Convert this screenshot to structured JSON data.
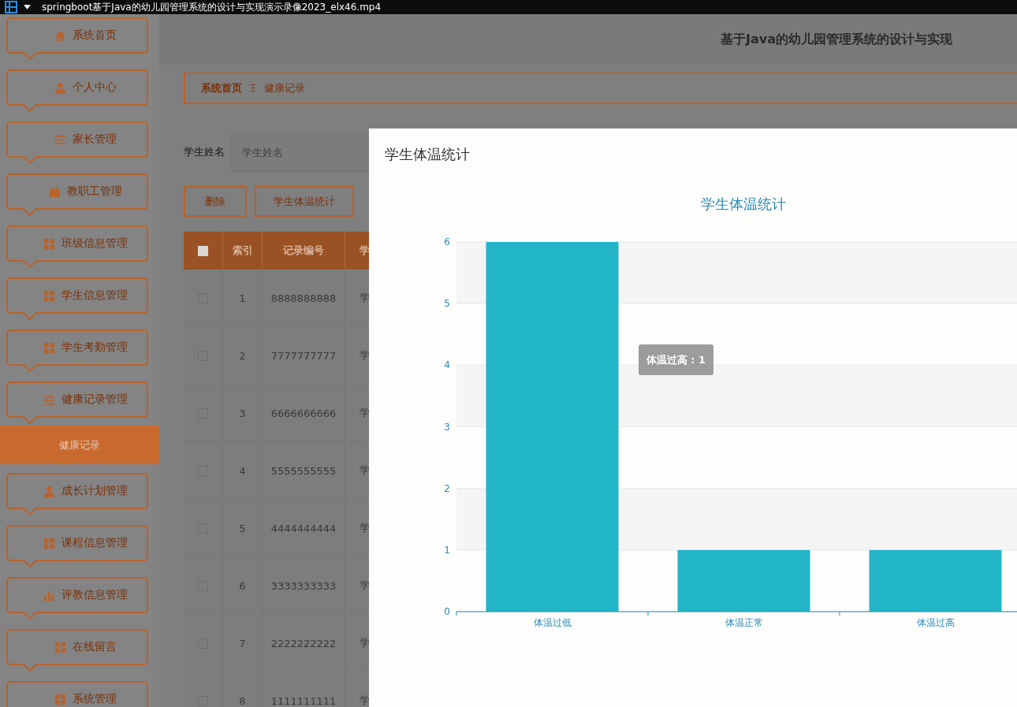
{
  "player_bar": {
    "title": "springboot基于Java的幼儿园管理系统的设计与实现演示录像2023_elx46.mp4"
  },
  "sidebar": {
    "items": [
      {
        "label": "系统首页",
        "kind": "home",
        "selected": false
      },
      {
        "label": "个人中心",
        "kind": "user",
        "selected": false
      },
      {
        "label": "家长管理",
        "kind": "list",
        "selected": false
      },
      {
        "label": "教职工管理",
        "kind": "briefcase",
        "selected": false
      },
      {
        "label": "班级信息管理",
        "kind": "grid",
        "selected": false
      },
      {
        "label": "学生信息管理",
        "kind": "grid",
        "selected": false
      },
      {
        "label": "学生考勤管理",
        "kind": "grid",
        "selected": false
      },
      {
        "label": "健康记录管理",
        "kind": "sliders",
        "selected": false,
        "children": [
          {
            "label": "健康记录",
            "selected": true
          }
        ]
      },
      {
        "label": "成长计划管理",
        "kind": "user",
        "selected": false
      },
      {
        "label": "课程信息管理",
        "kind": "grid",
        "selected": false
      },
      {
        "label": "评教信息管理",
        "kind": "chart",
        "selected": false
      },
      {
        "label": "在线留言",
        "kind": "grid",
        "selected": false
      },
      {
        "label": "系统管理",
        "kind": "grid",
        "selected": false
      }
    ]
  },
  "header": {
    "title": "基于Java的幼儿园管理系统的设计与实现"
  },
  "breadcrumb": [
    "系统首页",
    "健康记录"
  ],
  "breadcrumb_separator": "Ξ",
  "search": {
    "label": "学生姓名",
    "placeholder": "学生姓名"
  },
  "buttons": [
    "删除",
    "学生体温统计"
  ],
  "table": {
    "all_checked": false,
    "columns": [
      "索引",
      "记录编号",
      "学"
    ],
    "rows": [
      {
        "checked": false,
        "cells": [
          "1",
          "8888888888",
          "学"
        ]
      },
      {
        "checked": false,
        "cells": [
          "2",
          "7777777777",
          "学"
        ]
      },
      {
        "checked": false,
        "cells": [
          "3",
          "6666666666",
          "学"
        ]
      },
      {
        "checked": false,
        "cells": [
          "4",
          "5555555555",
          "学"
        ]
      },
      {
        "checked": false,
        "cells": [
          "5",
          "4444444444",
          "学"
        ]
      },
      {
        "checked": false,
        "cells": [
          "6",
          "3333333333",
          "学"
        ]
      },
      {
        "checked": false,
        "cells": [
          "7",
          "2222222222",
          "学"
        ]
      },
      {
        "checked": false,
        "cells": [
          "8",
          "1111111111",
          "学"
        ]
      }
    ]
  },
  "dialog": {
    "title": "学生体温统计",
    "tooltip": "体温过高 : 1",
    "chart_data": {
      "type": "bar",
      "title": "学生体温统计",
      "grid": true,
      "categories": [
        "体温过低",
        "体温正常",
        "体温过高"
      ],
      "series": [
        {
          "color": "#22b5c8",
          "values": [
            6,
            1,
            1
          ]
        }
      ],
      "ylim": [
        0,
        6
      ],
      "yticks": [
        0,
        1,
        2,
        3,
        4,
        5,
        6
      ]
    }
  }
}
